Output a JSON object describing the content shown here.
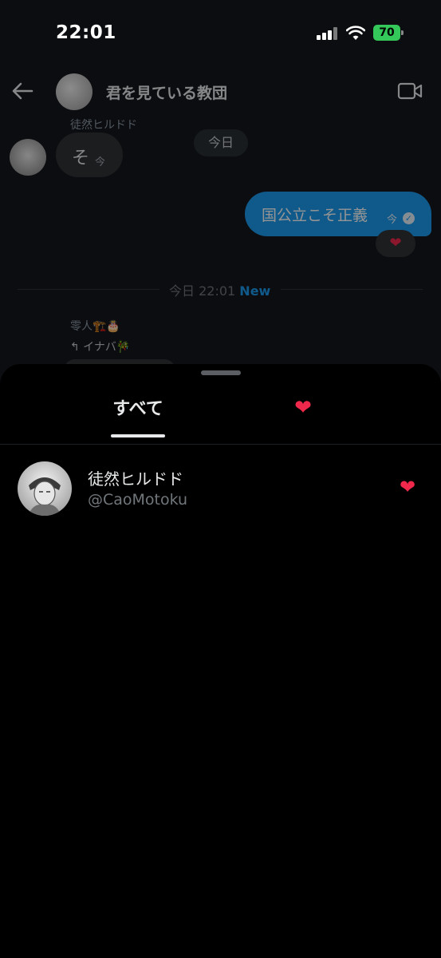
{
  "status_bar": {
    "time": "22:01",
    "battery": "70"
  },
  "chat": {
    "group_title": "君を見ている教団",
    "sender_name": "徒然ヒルドド",
    "left_message": {
      "text": "そ",
      "time": "今"
    },
    "date_pill": "今日",
    "right_message": {
      "text": "国公立こそ正義",
      "time": "今"
    },
    "reaction_emoji": "❤",
    "new_divider": {
      "timestamp": "今日 22:01",
      "label": "New"
    },
    "reply_sender": "零人🏗️🎂",
    "reply_quote": "↰ イナバ🎋"
  },
  "sheet": {
    "tabs": [
      {
        "label": "すべて",
        "selected": true
      },
      {
        "label": "❤",
        "selected": false
      }
    ],
    "users": [
      {
        "name": "徒然ヒルドド",
        "handle": "@CaoMotoku",
        "reaction": "❤"
      }
    ]
  },
  "colors": {
    "accent": "#1d9bf0",
    "heart": "#f0294c",
    "battery": "#34c759",
    "sheet_bg": "#000000",
    "chat_bg": "#15181c"
  }
}
